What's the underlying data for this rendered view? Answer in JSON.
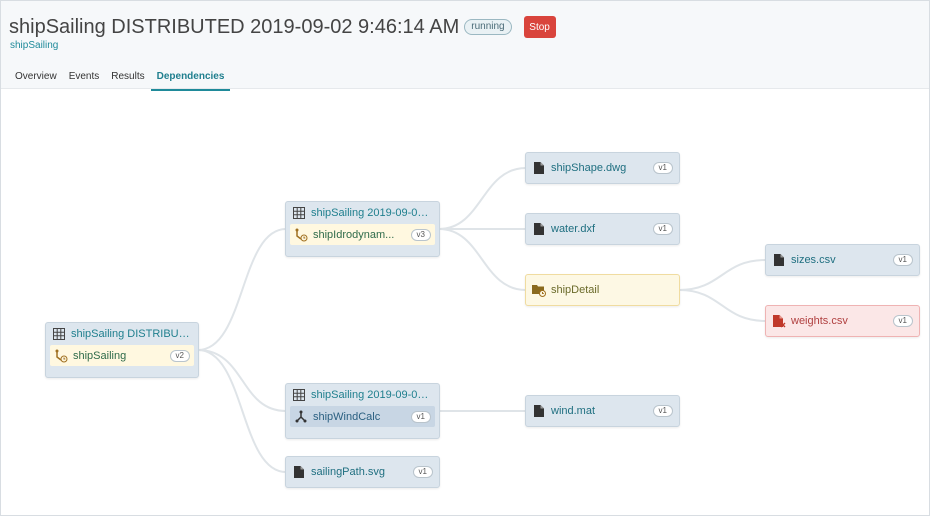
{
  "header": {
    "title": "shipSailing DISTRIBUTED 2019-09-02 9:46:14 AM",
    "status": "running",
    "stop_label": "Stop",
    "subtitle": "shipSailing"
  },
  "tabs": [
    {
      "label": "Overview",
      "active": false
    },
    {
      "label": "Events",
      "active": false
    },
    {
      "label": "Results",
      "active": false
    },
    {
      "label": "Dependencies",
      "active": true
    }
  ],
  "graph": {
    "root": {
      "title": "shipSailing DISTRIBUTED...",
      "process": "shipSailing",
      "version": "v2"
    },
    "run_a": {
      "title": "shipSailing 2019-09-02 ...",
      "process": "shipIdrodynam...",
      "version": "v3"
    },
    "run_b": {
      "title": "shipSailing 2019-09-02 ...",
      "process": "shipWindCalc",
      "version": "v1"
    },
    "files": {
      "sailing_path": {
        "name": "sailingPath.svg",
        "version": "v1"
      },
      "ship_shape": {
        "name": "shipShape.dwg",
        "version": "v1"
      },
      "water": {
        "name": "water.dxf",
        "version": "v1"
      },
      "ship_detail": {
        "name": "shipDetail"
      },
      "sizes": {
        "name": "sizes.csv",
        "version": "v1"
      },
      "weights": {
        "name": "weights.csv",
        "version": "v1"
      },
      "wind": {
        "name": "wind.mat",
        "version": "v1"
      }
    }
  },
  "colors": {
    "accent": "#1f8a9a",
    "stop": "#d9443c",
    "node_bg": "#dde6ee",
    "warn_bg": "#fdf8e4",
    "error_bg": "#fbe7e7"
  },
  "icons": {
    "run": "grid-icon",
    "process": "process-icon",
    "file": "file-icon",
    "folder": "folder-icon",
    "error_file": "file-error-icon"
  }
}
